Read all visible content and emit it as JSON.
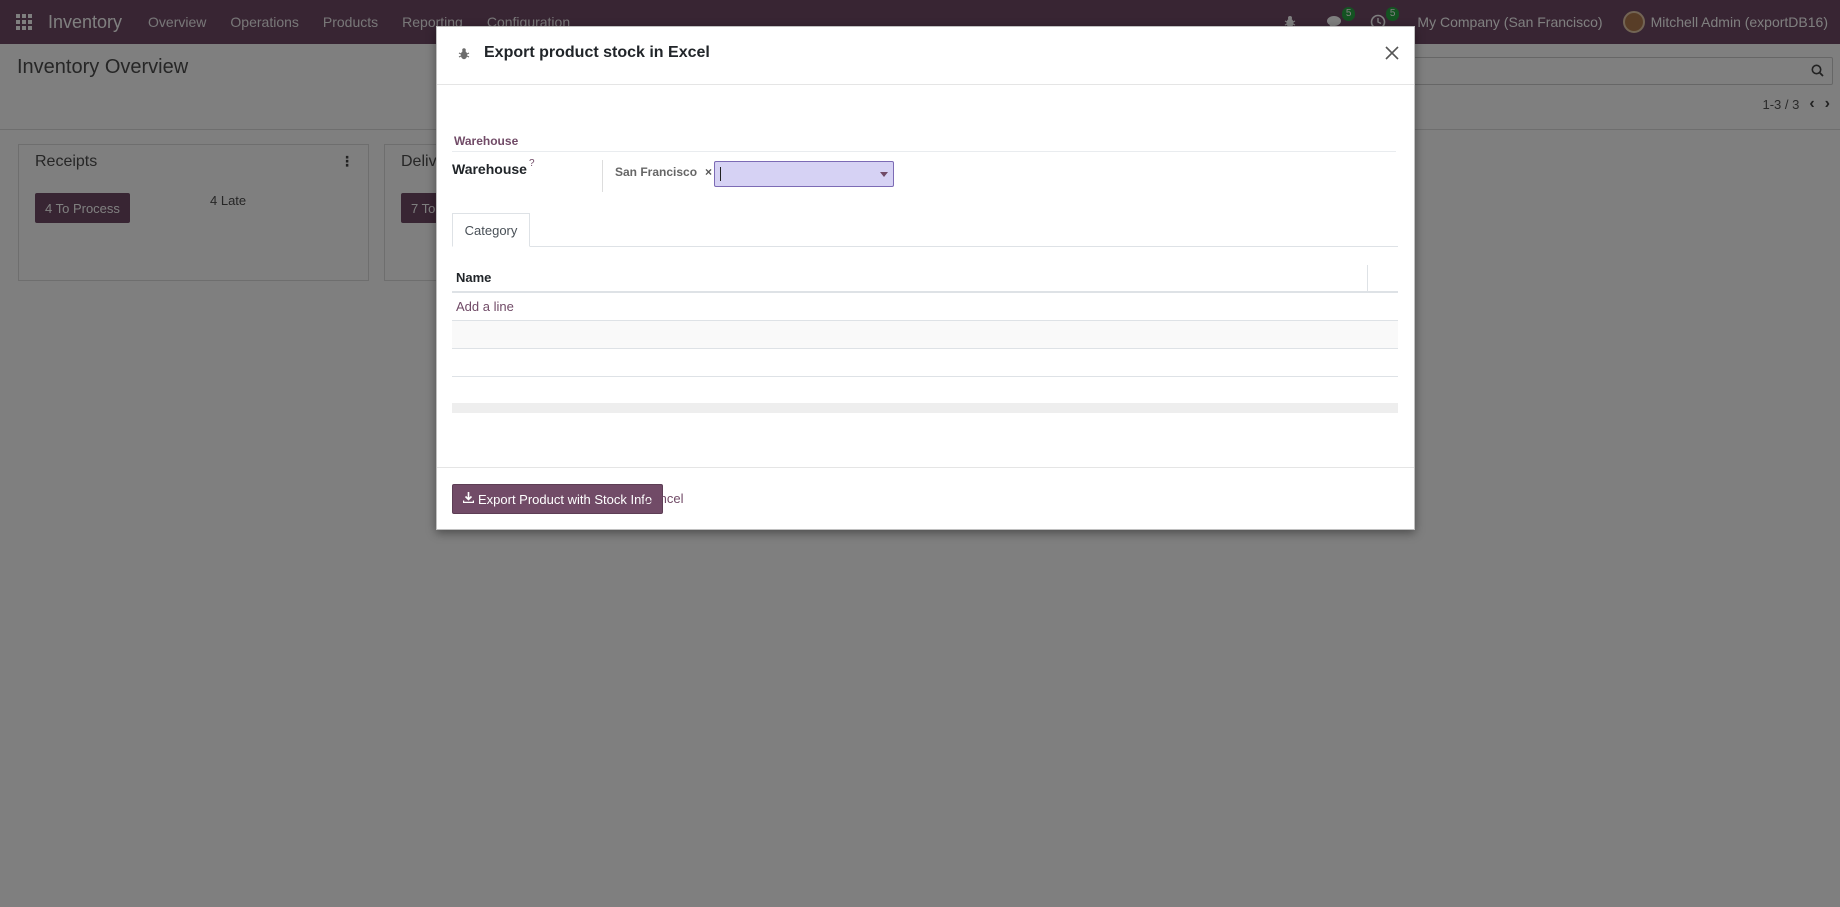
{
  "navbar": {
    "app_name": "Inventory",
    "menu": [
      "Overview",
      "Operations",
      "Products",
      "Reporting",
      "Configuration"
    ],
    "messages_count": "5",
    "activities_count": "5",
    "company": "My Company (San Francisco)",
    "user": "Mitchell Admin (exportDB16)"
  },
  "control_panel": {
    "title": "Inventory Overview",
    "pager": "1-3 / 3"
  },
  "kanban": {
    "cards": [
      {
        "title": "Receipts",
        "button": "4 To Process",
        "late": "4 Late"
      },
      {
        "title": "Deliv",
        "button": "7 To"
      }
    ]
  },
  "dialog": {
    "title": "Export product stock in Excel",
    "group_title": "Warehouse",
    "field_label": "Warehouse",
    "help": "?",
    "selected_tag": "San Francisco",
    "input_value": "",
    "tab": "Category",
    "list": {
      "column": "Name",
      "add_line": "Add a line"
    },
    "export_button": "Export Product with Stock Info",
    "cancel": "Cancel"
  },
  "colors": {
    "brand": "#714b67",
    "badge": "#28a745",
    "input_focus": "#d6d2f4"
  }
}
